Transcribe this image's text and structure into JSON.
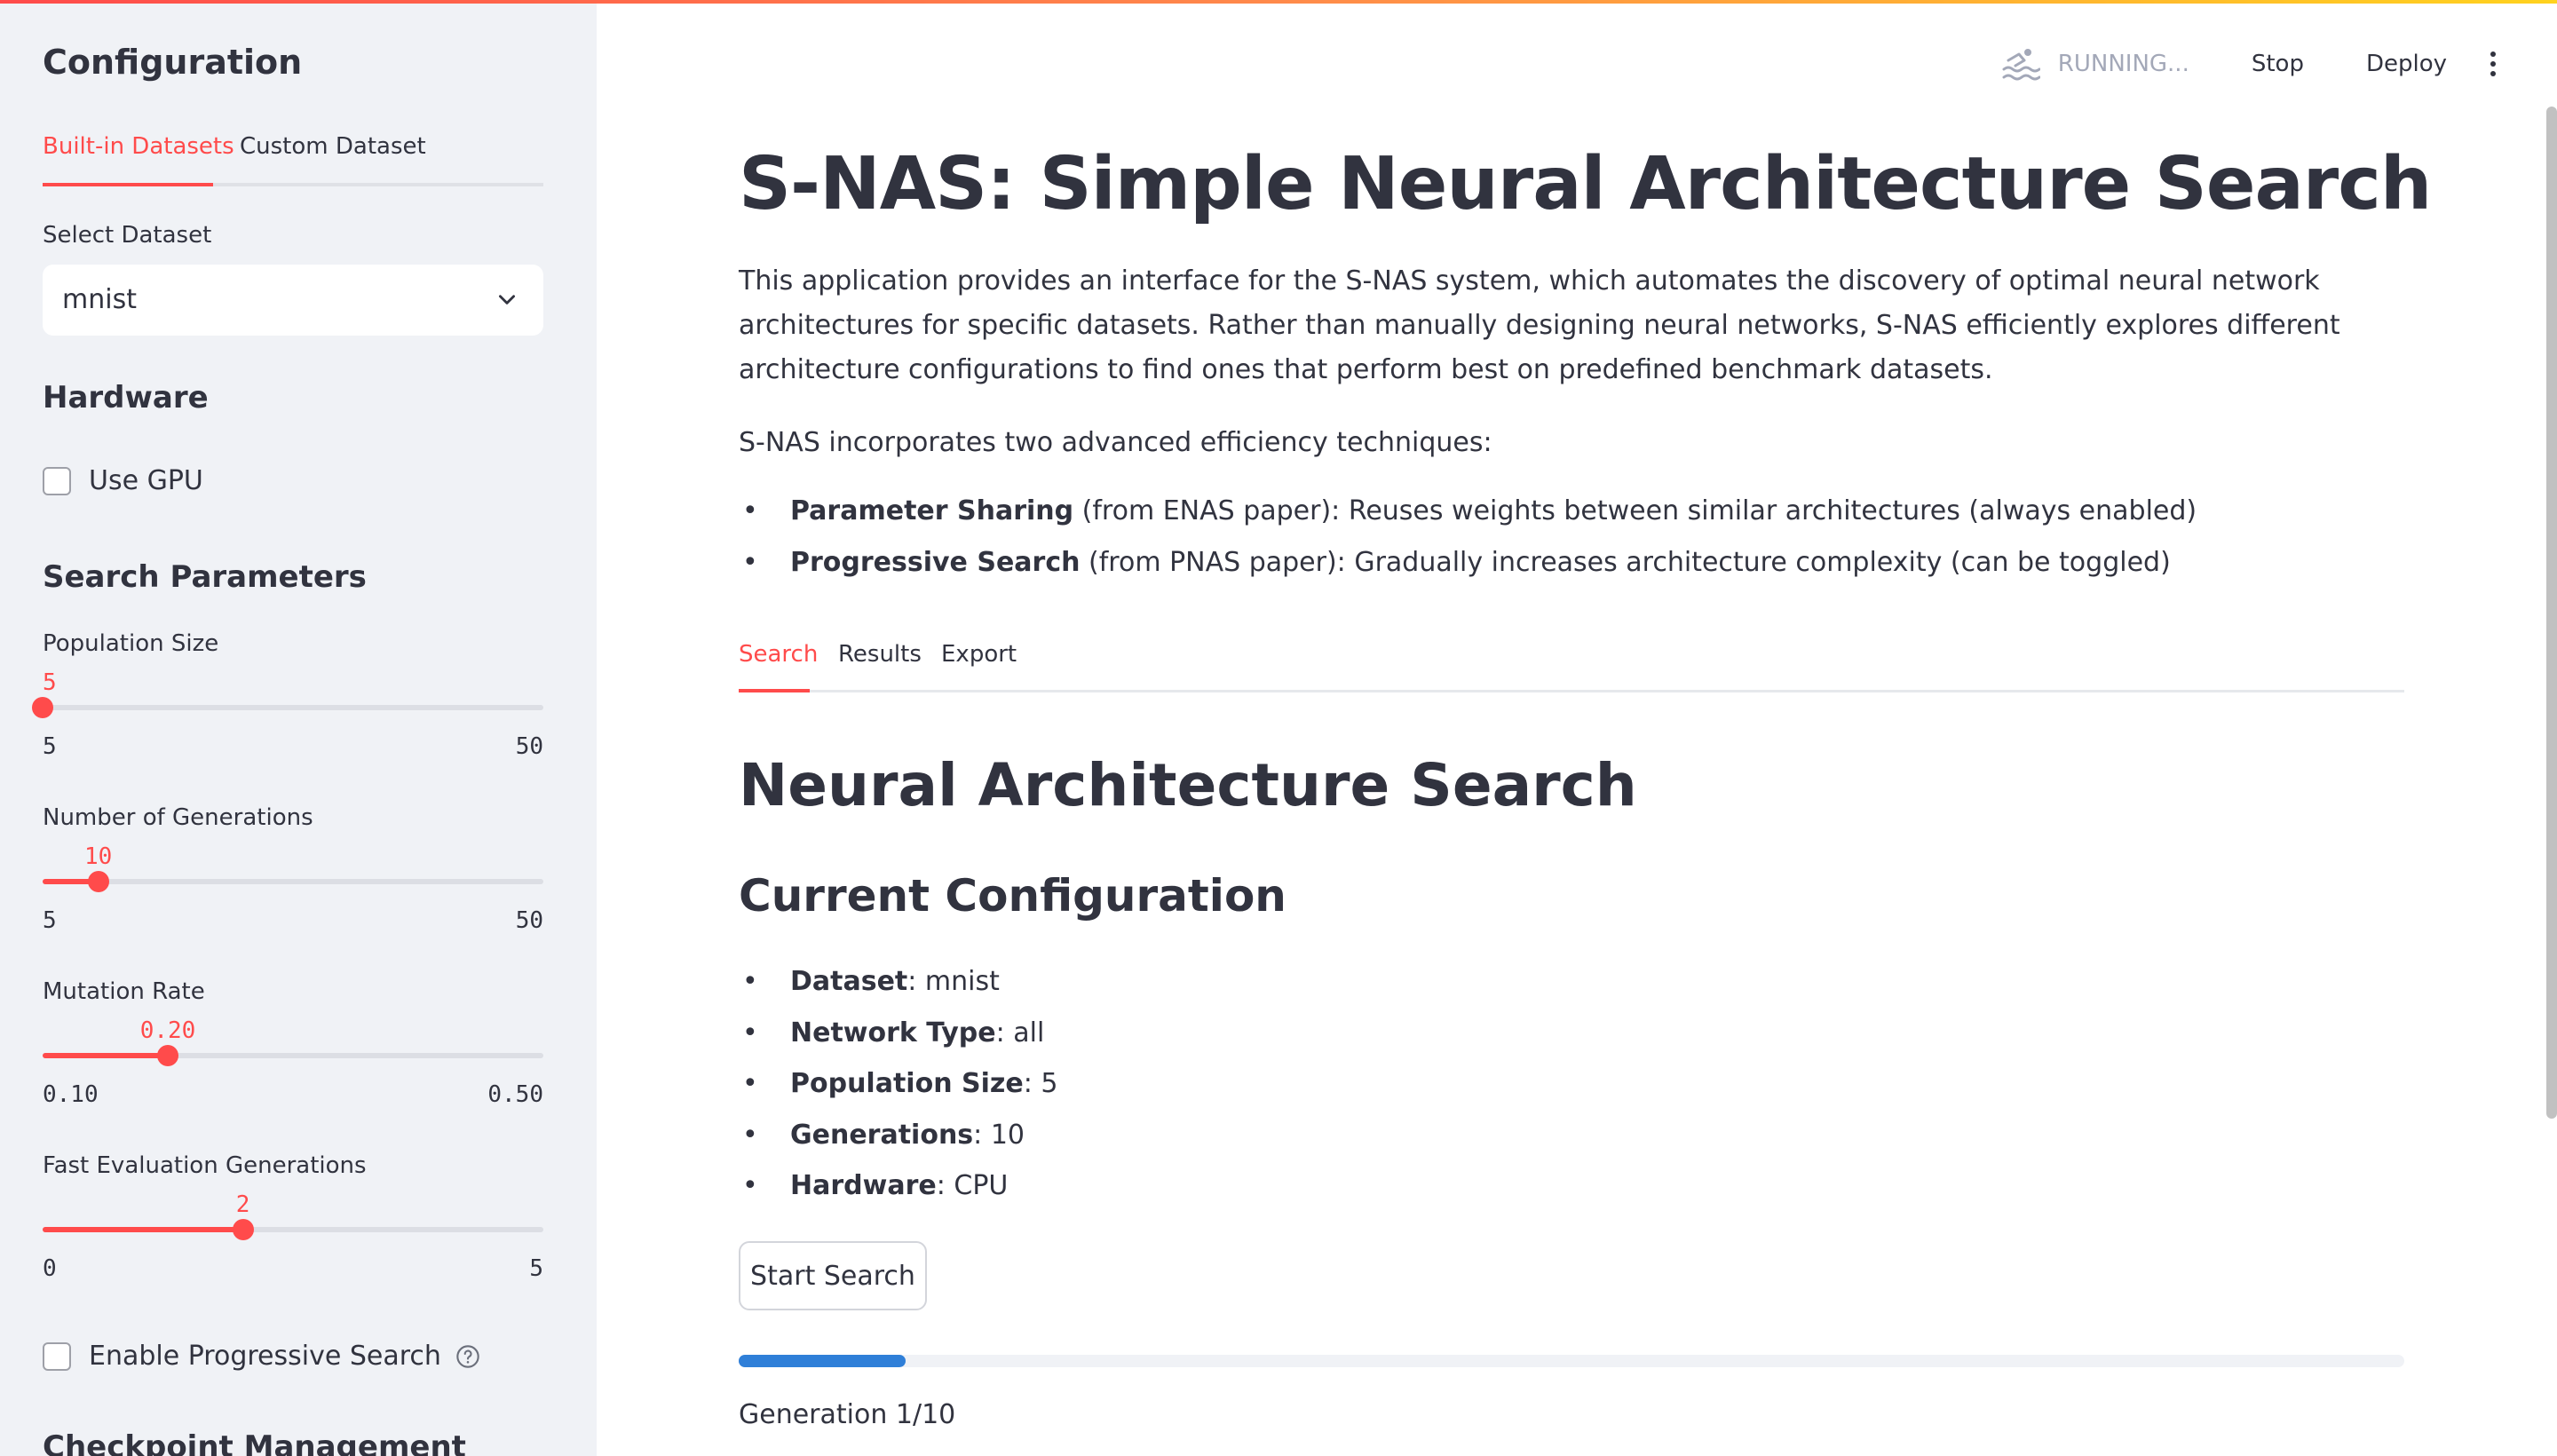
{
  "colors": {
    "accent": "#ff4b4b",
    "progress": "#2f7fd8",
    "sidebar_bg": "#f0f2f6",
    "text": "#31333f"
  },
  "sidebar": {
    "title": "Configuration",
    "tabs": [
      {
        "label": "Built-in Datasets",
        "active": true
      },
      {
        "label": "Custom Dataset",
        "active": false
      }
    ],
    "dataset": {
      "label": "Select Dataset",
      "value": "mnist",
      "icon": "chevron-down-icon"
    },
    "hardware": {
      "heading": "Hardware",
      "use_gpu_label": "Use GPU",
      "use_gpu_checked": false
    },
    "search_params": {
      "heading": "Search Parameters",
      "sliders": [
        {
          "label": "Population Size",
          "value": "5",
          "min": "5",
          "max": "50"
        },
        {
          "label": "Number of Generations",
          "value": "10",
          "min": "5",
          "max": "50"
        },
        {
          "label": "Mutation Rate",
          "value": "0.20",
          "min": "0.10",
          "max": "0.50"
        },
        {
          "label": "Fast Evaluation Generations",
          "value": "2",
          "min": "0",
          "max": "5"
        }
      ],
      "progressive_label": "Enable Progressive Search",
      "progressive_checked": false
    },
    "checkpoint_heading": "Checkpoint Management"
  },
  "toolbar": {
    "status": "RUNNING...",
    "status_icon": "swimmer-icon",
    "stop": "Stop",
    "deploy": "Deploy",
    "menu_icon": "kebab-menu-icon"
  },
  "main": {
    "title": "S-NAS: Simple Neural Architecture Search",
    "intro": "This application provides an interface for the S-NAS system, which automates the discovery of optimal neural network architectures for specific datasets. Rather than manually designing neural networks, S-NAS efficiently explores different architecture configurations to find ones that perform best on predefined benchmark datasets.",
    "techniques_intro": "S-NAS incorporates two advanced efficiency techniques:",
    "techniques": [
      {
        "bold": "Parameter Sharing",
        "text": " (from ENAS paper): Reuses weights between similar architectures (always enabled)"
      },
      {
        "bold": "Progressive Search",
        "text": " (from PNAS paper): Gradually increases architecture complexity (can be toggled)"
      }
    ],
    "tabs": [
      {
        "label": "Search",
        "active": true
      },
      {
        "label": "Results",
        "active": false
      },
      {
        "label": "Export",
        "active": false
      }
    ],
    "section_title": "Neural Architecture Search",
    "config_title": "Current Configuration",
    "config": [
      {
        "bold": "Dataset",
        "text": ": mnist"
      },
      {
        "bold": "Network Type",
        "text": ": all"
      },
      {
        "bold": "Population Size",
        "text": ": 5"
      },
      {
        "bold": "Generations",
        "text": ": 10"
      },
      {
        "bold": "Hardware",
        "text": ": CPU"
      }
    ],
    "start_button": "Start Search",
    "progress": 0.1,
    "generation_status": "Generation 1/10"
  }
}
